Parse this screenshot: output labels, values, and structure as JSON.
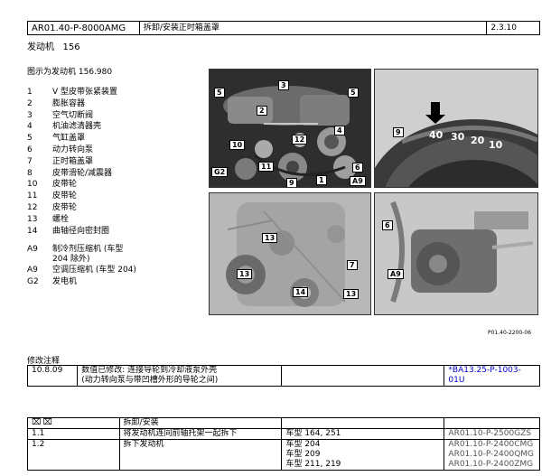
{
  "header": {
    "doc_id": "AR01.40-P-8000AMG",
    "title": "拆卸/安装正时箱盖罩",
    "version": "2.3.10"
  },
  "engine_line": "发动机   156",
  "figure_caption": "图示为发动机 156.980",
  "legend": [
    {
      "num": "1",
      "text": "V 型皮带张紧装置"
    },
    {
      "num": "2",
      "text": "膨胀容器"
    },
    {
      "num": "3",
      "text": "空气切断阀"
    },
    {
      "num": "4",
      "text": "机油滤清器壳"
    },
    {
      "num": "5",
      "text": "气缸盖罩"
    },
    {
      "num": "6",
      "text": "动力转向泵"
    },
    {
      "num": "7",
      "text": "正时箱盖罩"
    },
    {
      "num": "8",
      "text": "皮带滑轮/减震器"
    },
    {
      "num": "10",
      "text": "皮带轮"
    },
    {
      "num": "11",
      "text": "皮带轮"
    },
    {
      "num": "12",
      "text": "皮带轮"
    },
    {
      "num": "13",
      "text": "螺栓"
    },
    {
      "num": "14",
      "text": "曲轴径向密封圈"
    }
  ],
  "legend_components": [
    {
      "num": "A9",
      "text": "制冷剂压缩机 (车型 204 除外)"
    },
    {
      "num": "A9",
      "text": "空调压缩机 (车型 204)"
    },
    {
      "num": "G2",
      "text": "发电机"
    }
  ],
  "photo_callouts": {
    "top_left": [
      "5",
      "3",
      "5",
      "2",
      "4",
      "10",
      "11",
      "12",
      "G2",
      "9",
      "1",
      "A9",
      "6"
    ],
    "top_right": [
      "9",
      "40",
      "30",
      "20",
      "10"
    ],
    "bottom_left": [
      "7",
      "13",
      "13",
      "14",
      "13"
    ],
    "bottom_right": [
      "6",
      "A9"
    ]
  },
  "figure_id": "P01.40-2200-06",
  "notes_heading": "修改注释",
  "notes": [
    {
      "date": "10.8.09",
      "text_line1": "数值已修改: 连接导轮到冷却液泵外壳",
      "text_line2": "(动力转向泵与带凹槽外形的导轮之间)",
      "reference": "*BA13.25-P-1003-01U"
    }
  ],
  "ops_header": {
    "icons": "⌧⌧",
    "label": "拆卸/安装"
  },
  "ops": [
    {
      "step": "1.1",
      "text": "将发动机连同前轴托架一起拆下",
      "models": [
        "车型 164, 251"
      ],
      "refs": [
        "AR01.10-P-2500GZS"
      ]
    },
    {
      "step": "1.2",
      "text": "拆下发动机",
      "models": [
        "车型 204",
        "车型 209",
        "车型 211, 219"
      ],
      "refs": [
        "AR01.10-P-2400CMG",
        "AR01.10-P-2400QMG",
        "AR01.10-P-2400ZMG"
      ]
    }
  ]
}
